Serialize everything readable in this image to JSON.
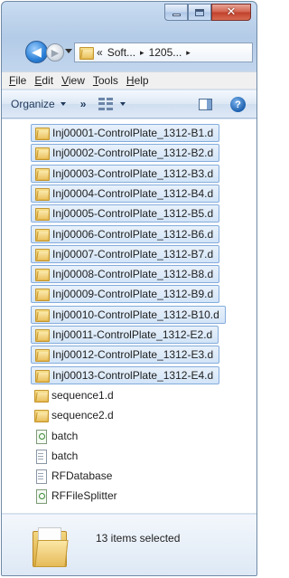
{
  "window": {
    "caption_buttons": {
      "minimize": "minimize",
      "maximize": "maximize",
      "close": "close"
    }
  },
  "address_bar": {
    "chevron": "«",
    "segments": [
      "Soft...",
      "1205..."
    ],
    "separator": "▸"
  },
  "menu": {
    "items": [
      {
        "underline": "F",
        "rest": "ile"
      },
      {
        "underline": "E",
        "rest": "dit"
      },
      {
        "underline": "V",
        "rest": "iew"
      },
      {
        "underline": "T",
        "rest": "ools"
      },
      {
        "underline": "H",
        "rest": "elp"
      }
    ]
  },
  "toolbar": {
    "organize_label": "Organize",
    "more_label": "»",
    "icons": [
      "views-icon",
      "preview-pane-icon",
      "help-icon"
    ]
  },
  "files": [
    {
      "name": "Inj00001-ControlPlate_1312-B1.d",
      "icon": "folder-icon",
      "selected": true
    },
    {
      "name": "Inj00002-ControlPlate_1312-B2.d",
      "icon": "folder-icon",
      "selected": true
    },
    {
      "name": "Inj00003-ControlPlate_1312-B3.d",
      "icon": "folder-icon",
      "selected": true
    },
    {
      "name": "Inj00004-ControlPlate_1312-B4.d",
      "icon": "folder-icon",
      "selected": true
    },
    {
      "name": "Inj00005-ControlPlate_1312-B5.d",
      "icon": "folder-icon",
      "selected": true
    },
    {
      "name": "Inj00006-ControlPlate_1312-B6.d",
      "icon": "folder-icon",
      "selected": true
    },
    {
      "name": "Inj00007-ControlPlate_1312-B7.d",
      "icon": "folder-icon",
      "selected": true
    },
    {
      "name": "Inj00008-ControlPlate_1312-B8.d",
      "icon": "folder-icon",
      "selected": true
    },
    {
      "name": "Inj00009-ControlPlate_1312-B9.d",
      "icon": "folder-icon",
      "selected": true
    },
    {
      "name": "Inj00010-ControlPlate_1312-B10.d",
      "icon": "folder-icon",
      "selected": true
    },
    {
      "name": "Inj00011-ControlPlate_1312-E2.d",
      "icon": "folder-icon",
      "selected": true
    },
    {
      "name": "Inj00012-ControlPlate_1312-E3.d",
      "icon": "folder-icon",
      "selected": true
    },
    {
      "name": "Inj00013-ControlPlate_1312-E4.d",
      "icon": "folder-icon",
      "selected": true
    },
    {
      "name": "sequence1.d",
      "icon": "folder-icon",
      "selected": false
    },
    {
      "name": "sequence2.d",
      "icon": "folder-icon",
      "selected": false
    },
    {
      "name": "batch",
      "icon": "exe-icon",
      "selected": false
    },
    {
      "name": "batch",
      "icon": "doc-icon",
      "selected": false
    },
    {
      "name": "RFDatabase",
      "icon": "doc-icon",
      "selected": false
    },
    {
      "name": "RFFileSplitter",
      "icon": "exe-icon",
      "selected": false
    }
  ],
  "details": {
    "selection_text": "13 items selected"
  },
  "colors": {
    "selection_fill": "#d2e4f7",
    "selection_border": "#84acdd",
    "close_button": "#c0402b"
  }
}
